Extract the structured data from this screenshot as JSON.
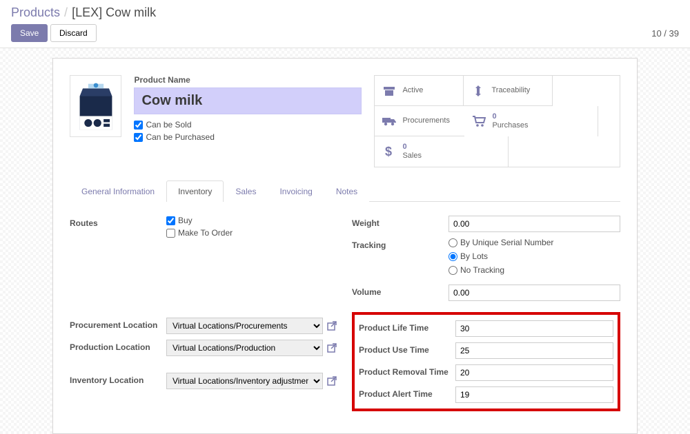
{
  "breadcrumb": {
    "root": "Products",
    "sep": "/",
    "current": "[LEX] Cow milk"
  },
  "buttons": {
    "save": "Save",
    "discard": "Discard"
  },
  "pager": "10 / 39",
  "product": {
    "name_label": "Product Name",
    "name": "Cow milk",
    "can_be_sold_label": "Can be Sold",
    "can_be_sold": true,
    "can_be_purchased_label": "Can be Purchased",
    "can_be_purchased": true
  },
  "stats": {
    "active": "Active",
    "traceability": "Traceability",
    "procurements": "Procurements",
    "purchases_count": "0",
    "purchases": "Purchases",
    "sales_count": "0",
    "sales": "Sales"
  },
  "tabs": {
    "general": "General Information",
    "inventory": "Inventory",
    "sales": "Sales",
    "invoicing": "Invoicing",
    "notes": "Notes"
  },
  "left": {
    "routes_label": "Routes",
    "routes_buy": "Buy",
    "routes_mto": "Make To Order",
    "procurement_loc_label": "Procurement Location",
    "procurement_loc": "Virtual Locations/Procurements",
    "production_loc_label": "Production Location",
    "production_loc": "Virtual Locations/Production",
    "inventory_loc_label": "Inventory Location",
    "inventory_loc": "Virtual Locations/Inventory adjustment"
  },
  "right": {
    "weight_label": "Weight",
    "weight": "0.00",
    "tracking_label": "Tracking",
    "tracking_serial": "By Unique Serial Number",
    "tracking_lots": "By Lots",
    "tracking_none": "No Tracking",
    "volume_label": "Volume",
    "volume": "0.00",
    "life_time_label": "Product Life Time",
    "life_time": "30",
    "use_time_label": "Product Use Time",
    "use_time": "25",
    "removal_time_label": "Product Removal Time",
    "removal_time": "20",
    "alert_time_label": "Product Alert Time",
    "alert_time": "19"
  }
}
